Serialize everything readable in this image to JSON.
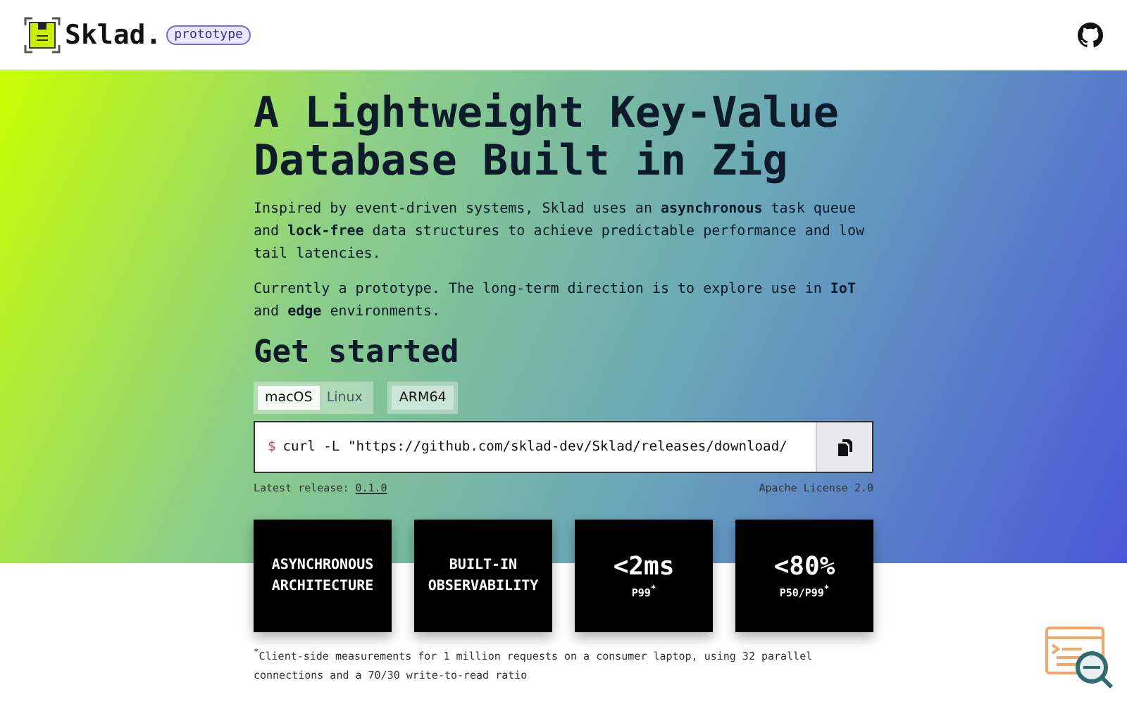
{
  "header": {
    "brand": "Sklad.",
    "badge": "prototype"
  },
  "hero": {
    "title": "A Lightweight Key-Value Database Built in Zig",
    "paragraphs": [
      "Inspired by event-driven systems, Sklad uses an **asynchronous** task queue and **lock-free** data structures to achieve predictable performance and low tail latencies.",
      "Currently a prototype. The long-term direction is to explore use in **IoT** and **edge** environments."
    ]
  },
  "get_started": {
    "heading": "Get started",
    "tab_groups": [
      [
        {
          "label": "macOS",
          "selected": true
        },
        {
          "label": "Linux",
          "selected": false
        }
      ],
      [
        {
          "label": "ARM64",
          "selected": true
        }
      ]
    ],
    "command": {
      "prompt": "$",
      "text": "curl -L \"https://github.com/sklad-dev/Sklad/releases/download/"
    },
    "release_label": "Latest release:",
    "release_link": "0.1.0",
    "license": "Apache License 2.0"
  },
  "cards": [
    {
      "kind": "feature",
      "text": "ASYNCHRONOUS ARCHITECTURE"
    },
    {
      "kind": "feature",
      "text": "BUILT-IN OBSERVABILITY"
    },
    {
      "kind": "metric",
      "value": "<2ms",
      "label": "P99$^{*}$"
    },
    {
      "kind": "metric",
      "value": "<80%",
      "label": "P50/P99$^{*}$"
    }
  ],
  "footnote": "$^{*}$Client-side measurements for 1 million requests on a consumer laptop, using 32 parallel connections and a 70/30 write-to-read ratio"
}
